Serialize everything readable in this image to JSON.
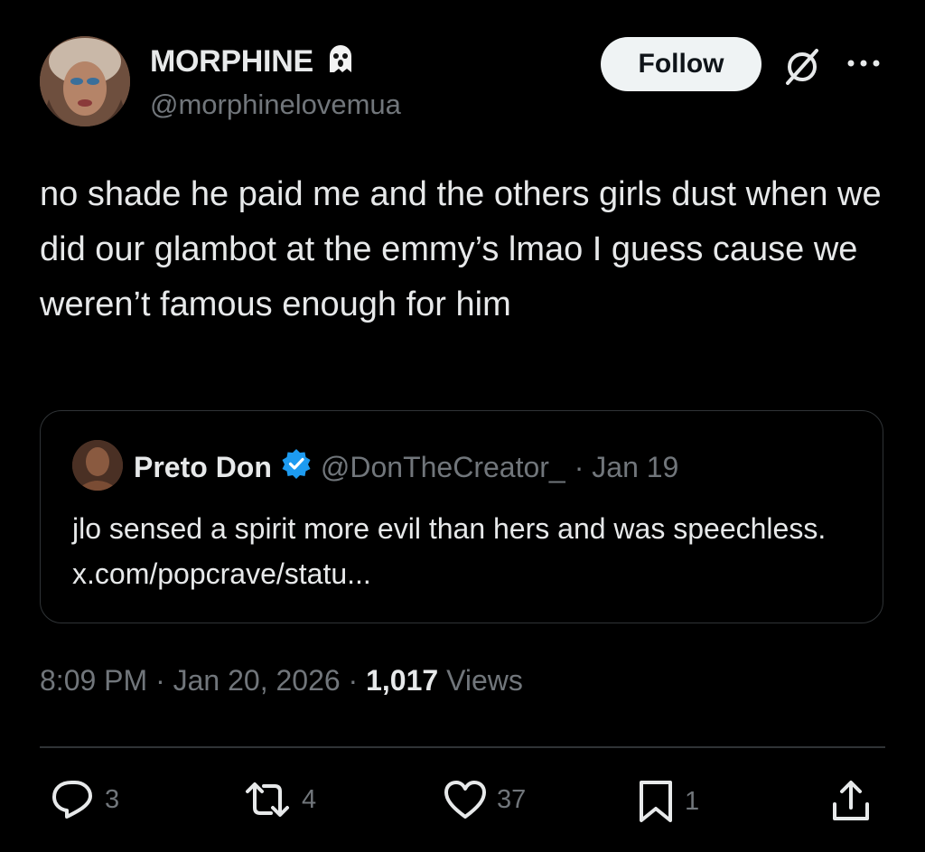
{
  "author": {
    "name": "MORPHINE",
    "handle": "@morphinelovemua",
    "name_emoji": "ghost-emoji"
  },
  "follow_label": "Follow",
  "icons": {
    "grok": "grok-icon",
    "more": "more-icon"
  },
  "tweet_text": "no shade he paid me and the others girls dust when we did our glambot at the emmy’s lmao I guess cause we weren’t famous enough for him",
  "quoted": {
    "name": "Preto Don",
    "verified": true,
    "handle": "@DonTheCreator_",
    "date": "· Jan 19",
    "text": "jlo sensed a spirit more evil than hers and was speechless. x.com/popcrave/statu..."
  },
  "meta": {
    "time": "8:09 PM",
    "date": "Jan 20, 2026",
    "views_count": "1,017",
    "views_label": "Views"
  },
  "actions": {
    "replies": "3",
    "reposts": "4",
    "likes": "37",
    "bookmarks": "1"
  },
  "colors": {
    "background": "#000000",
    "text": "#e7e9ea",
    "secondary": "#71767b",
    "verified": "#1d9bf0",
    "border": "#2f3336"
  }
}
